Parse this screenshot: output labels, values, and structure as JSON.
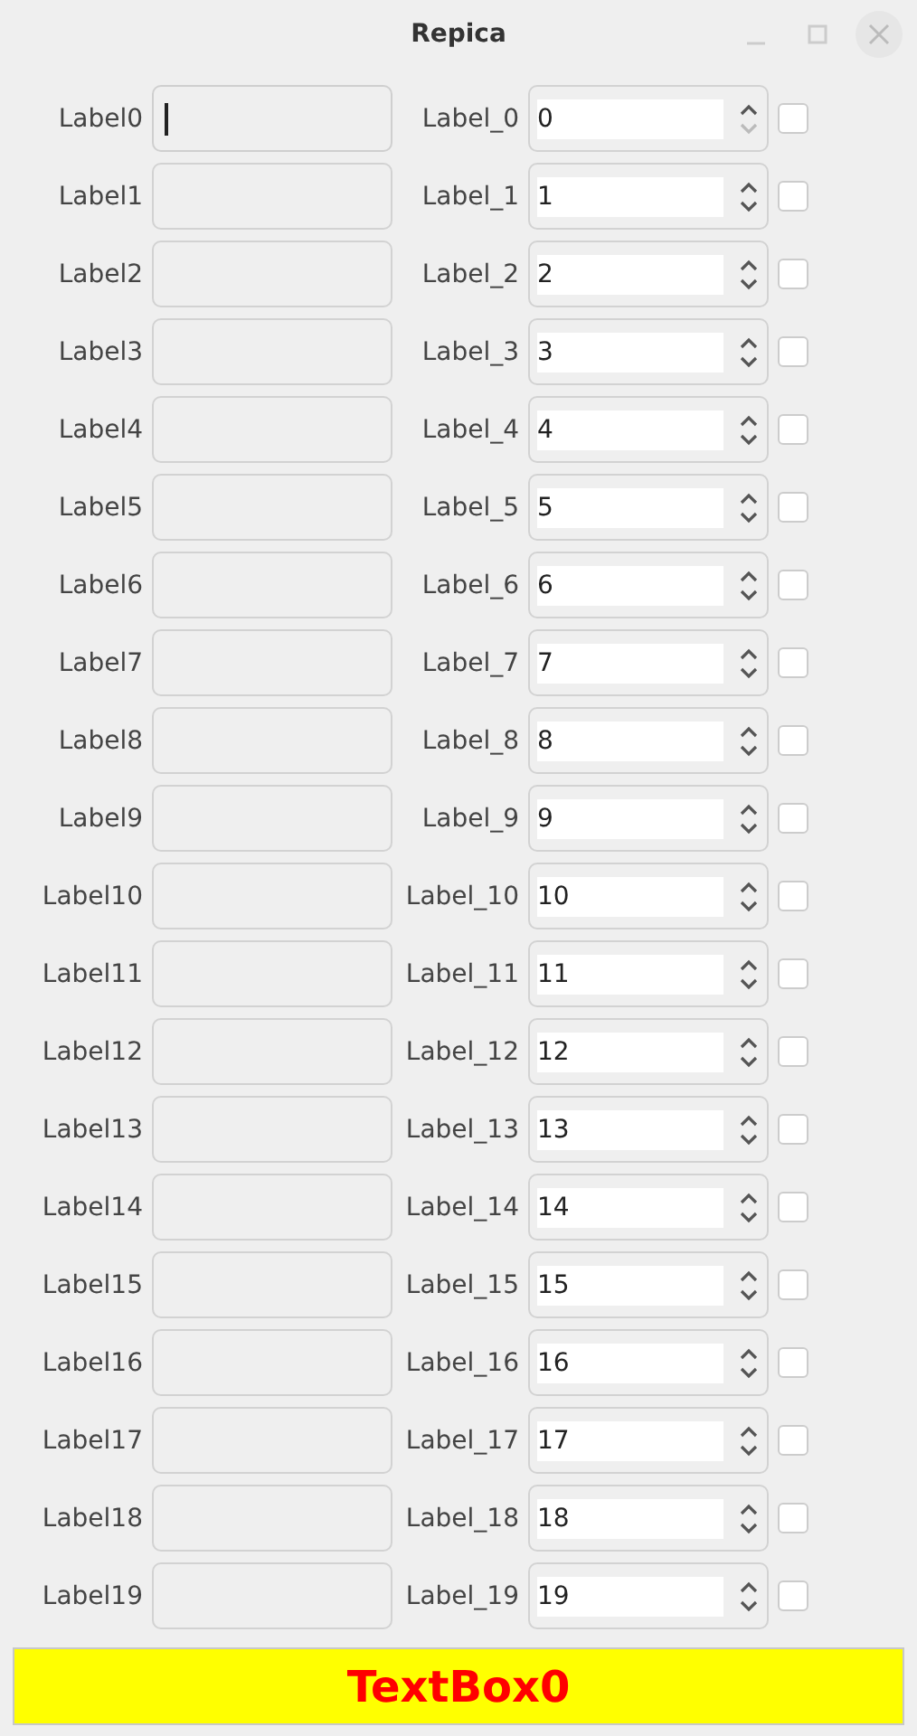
{
  "window": {
    "title": "Repica"
  },
  "rows": [
    {
      "label": "Label0",
      "text": {
        "focused": true
      },
      "spin_label": "Label_0",
      "spin": {
        "value": "0",
        "down_disabled": true
      },
      "checked": false
    },
    {
      "label": "Label1",
      "text": {
        "focused": false
      },
      "spin_label": "Label_1",
      "spin": {
        "value": "1",
        "down_disabled": false
      },
      "checked": false
    },
    {
      "label": "Label2",
      "text": {
        "focused": false
      },
      "spin_label": "Label_2",
      "spin": {
        "value": "2",
        "down_disabled": false
      },
      "checked": false
    },
    {
      "label": "Label3",
      "text": {
        "focused": false
      },
      "spin_label": "Label_3",
      "spin": {
        "value": "3",
        "down_disabled": false
      },
      "checked": false
    },
    {
      "label": "Label4",
      "text": {
        "focused": false
      },
      "spin_label": "Label_4",
      "spin": {
        "value": "4",
        "down_disabled": false
      },
      "checked": false
    },
    {
      "label": "Label5",
      "text": {
        "focused": false
      },
      "spin_label": "Label_5",
      "spin": {
        "value": "5",
        "down_disabled": false
      },
      "checked": false
    },
    {
      "label": "Label6",
      "text": {
        "focused": false
      },
      "spin_label": "Label_6",
      "spin": {
        "value": "6",
        "down_disabled": false
      },
      "checked": false
    },
    {
      "label": "Label7",
      "text": {
        "focused": false
      },
      "spin_label": "Label_7",
      "spin": {
        "value": "7",
        "down_disabled": false
      },
      "checked": false
    },
    {
      "label": "Label8",
      "text": {
        "focused": false
      },
      "spin_label": "Label_8",
      "spin": {
        "value": "8",
        "down_disabled": false
      },
      "checked": false
    },
    {
      "label": "Label9",
      "text": {
        "focused": false
      },
      "spin_label": "Label_9",
      "spin": {
        "value": "9",
        "down_disabled": false
      },
      "checked": false
    },
    {
      "label": "Label10",
      "text": {
        "focused": false
      },
      "spin_label": "Label_10",
      "spin": {
        "value": "10",
        "down_disabled": false
      },
      "checked": false
    },
    {
      "label": "Label11",
      "text": {
        "focused": false
      },
      "spin_label": "Label_11",
      "spin": {
        "value": "11",
        "down_disabled": false
      },
      "checked": false
    },
    {
      "label": "Label12",
      "text": {
        "focused": false
      },
      "spin_label": "Label_12",
      "spin": {
        "value": "12",
        "down_disabled": false
      },
      "checked": false
    },
    {
      "label": "Label13",
      "text": {
        "focused": false
      },
      "spin_label": "Label_13",
      "spin": {
        "value": "13",
        "down_disabled": false
      },
      "checked": false
    },
    {
      "label": "Label14",
      "text": {
        "focused": false
      },
      "spin_label": "Label_14",
      "spin": {
        "value": "14",
        "down_disabled": false
      },
      "checked": false
    },
    {
      "label": "Label15",
      "text": {
        "focused": false
      },
      "spin_label": "Label_15",
      "spin": {
        "value": "15",
        "down_disabled": false
      },
      "checked": false
    },
    {
      "label": "Label16",
      "text": {
        "focused": false
      },
      "spin_label": "Label_16",
      "spin": {
        "value": "16",
        "down_disabled": false
      },
      "checked": false
    },
    {
      "label": "Label17",
      "text": {
        "focused": false
      },
      "spin_label": "Label_17",
      "spin": {
        "value": "17",
        "down_disabled": false
      },
      "checked": false
    },
    {
      "label": "Label18",
      "text": {
        "focused": false
      },
      "spin_label": "Label_18",
      "spin": {
        "value": "18",
        "down_disabled": false
      },
      "checked": false
    },
    {
      "label": "Label19",
      "text": {
        "focused": false
      },
      "spin_label": "Label_19",
      "spin": {
        "value": "19",
        "down_disabled": false
      },
      "checked": false
    }
  ],
  "banner": {
    "text": "TextBox0"
  }
}
